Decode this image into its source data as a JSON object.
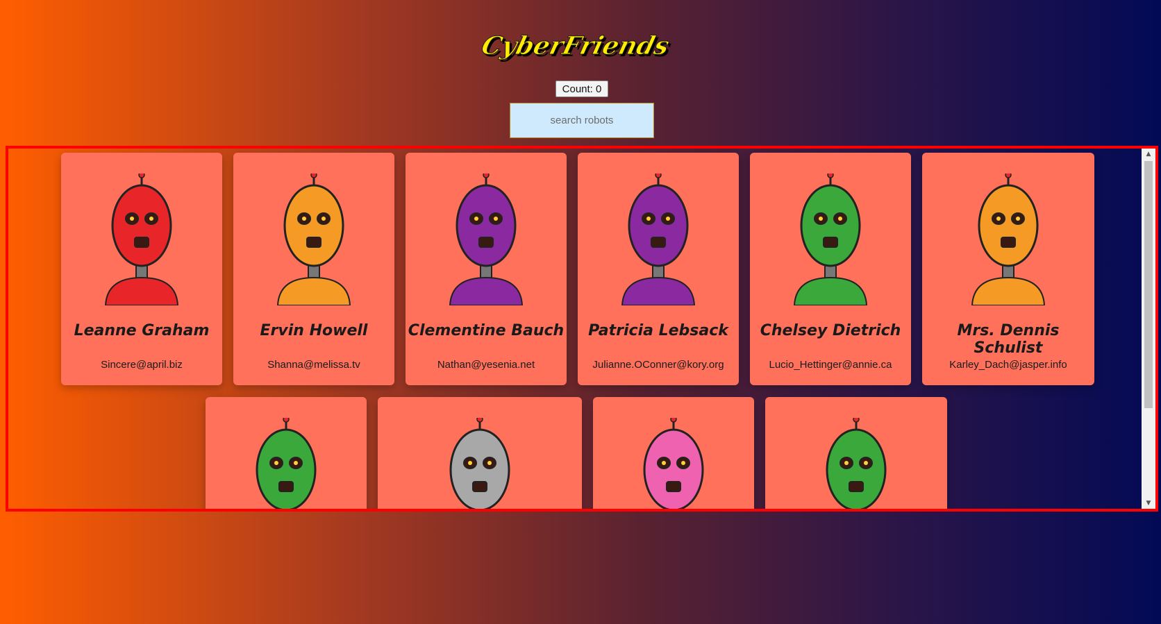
{
  "app": {
    "logo_text": "CyberFriends"
  },
  "counter": {
    "label": "Count: 0"
  },
  "search": {
    "placeholder": "search robots"
  },
  "colors": {
    "card": "#ff715b",
    "frame_border": "#ff0000",
    "logo": "#ffec00"
  },
  "robots": [
    {
      "name": "Leanne Graham",
      "email": "Sincere@april.biz",
      "color": "#e8262a"
    },
    {
      "name": "Ervin Howell",
      "email": "Shanna@melissa.tv",
      "color": "#f59a24"
    },
    {
      "name": "Clementine Bauch",
      "email": "Nathan@yesenia.net",
      "color": "#8b2aa0"
    },
    {
      "name": "Patricia Lebsack",
      "email": "Julianne.OConner@kory.org",
      "color": "#8b2aa0"
    },
    {
      "name": "Chelsey Dietrich",
      "email": "Lucio_Hettinger@annie.ca",
      "color": "#3aa83a"
    },
    {
      "name": "Mrs. Dennis Schulist",
      "email": "Karley_Dach@jasper.info",
      "color": "#f59a24"
    },
    {
      "name": "",
      "email": "",
      "color": "#3aa83a"
    },
    {
      "name": "",
      "email": "",
      "color": "#a8a8a8"
    },
    {
      "name": "",
      "email": "",
      "color": "#ee62b0"
    },
    {
      "name": "",
      "email": "",
      "color": "#3aa83a"
    }
  ]
}
